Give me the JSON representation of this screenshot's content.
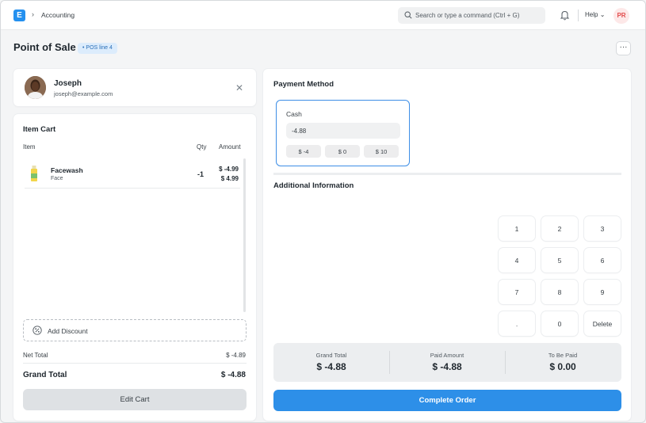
{
  "navbar": {
    "logo_letter": "E",
    "breadcrumb_sep": "›",
    "breadcrumb": "Accounting",
    "search_placeholder": "Search or type a command (Ctrl + G)",
    "help_label": "Help",
    "help_chevron": "⌄",
    "user_initials": "PR"
  },
  "page": {
    "title": "Point of Sale",
    "badge": "• POS line 4",
    "more_label": "···"
  },
  "customer": {
    "name": "Joseph",
    "email": "joseph@example.com",
    "close_symbol": "✕"
  },
  "cart": {
    "title": "Item Cart",
    "columns": {
      "item": "Item",
      "qty": "Qty",
      "amount": "Amount"
    },
    "items": [
      {
        "name": "Facewash",
        "group": "Face",
        "qty": "-1",
        "amount": "$ -4.99",
        "rate": "$ 4.99"
      }
    ],
    "add_discount": "Add Discount",
    "net_total_label": "Net Total",
    "net_total_value": "$ -4.89",
    "grand_total_label": "Grand Total",
    "grand_total_value": "$ -4.88",
    "edit_cart": "Edit Cart"
  },
  "payment": {
    "title": "Payment Method",
    "mode": "Cash",
    "amount_value": "-4.88",
    "quick_amounts": [
      "$ -4",
      "$ 0",
      "$ 10"
    ],
    "additional_info_title": "Additional Information",
    "keypad": [
      "1",
      "2",
      "3",
      "4",
      "5",
      "6",
      "7",
      "8",
      "9",
      ".",
      "0",
      "Delete"
    ],
    "totals": {
      "grand_total_label": "Grand Total",
      "grand_total_value": "$ -4.88",
      "paid_amount_label": "Paid Amount",
      "paid_amount_value": "$ -4.88",
      "to_be_paid_label": "To Be Paid",
      "to_be_paid_value": "$ 0.00"
    },
    "complete_order": "Complete Order"
  },
  "colors": {
    "primary": "#2d8fe8",
    "badge_bg": "#dcecfc",
    "avatar_bg": "#fde8e8",
    "avatar_text": "#e24c4c"
  }
}
